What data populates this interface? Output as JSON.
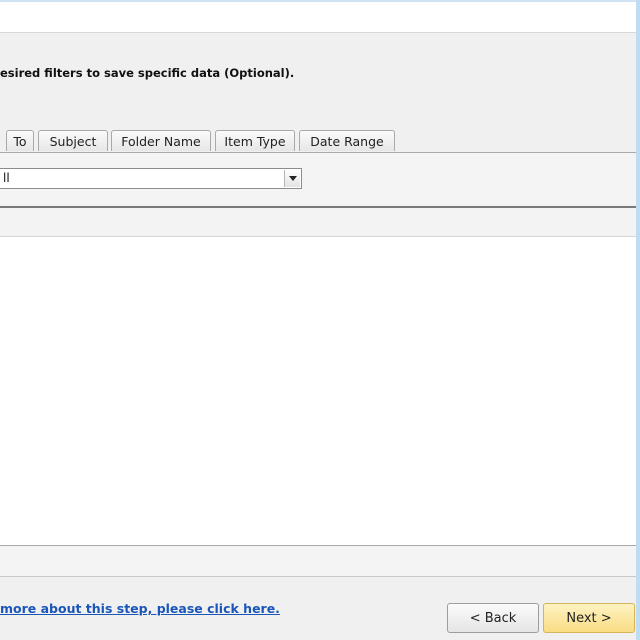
{
  "instruction": "esired filters to save specific data (Optional).",
  "tabs": [
    {
      "label": "To"
    },
    {
      "label": "Subject"
    },
    {
      "label": "Folder Name"
    },
    {
      "label": "Item Type"
    },
    {
      "label": "Date Range"
    }
  ],
  "filter": {
    "selected_value": "ll"
  },
  "footer": {
    "help_link": "more about this step, please click here.",
    "back_label": "< Back",
    "next_label": "Next >"
  },
  "colors": {
    "link": "#1a56b8",
    "next_button": "#f9dc84",
    "window_border": "#bfdcf2"
  },
  "icons": {
    "dropdown": "chevron-down-icon"
  }
}
